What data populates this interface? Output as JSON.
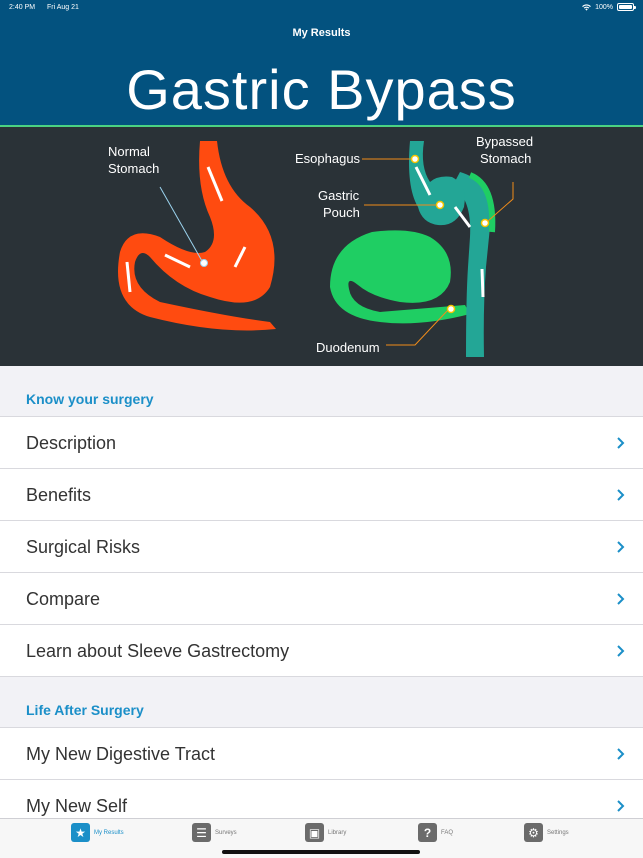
{
  "status": {
    "time": "2:40 PM",
    "date": "Fri Aug 21",
    "battery": "100%",
    "battery_level": 1.0
  },
  "header": {
    "nav_title": "My Results",
    "title": "Gastric Bypass"
  },
  "diagram": {
    "normal_stomach": "Normal\nStomach",
    "normal_stomach_l1": "Normal",
    "normal_stomach_l2": "Stomach",
    "esophagus": "Esophagus",
    "gastric_pouch_l1": "Gastric",
    "gastric_pouch_l2": "Pouch",
    "bypassed_l1": "Bypassed",
    "bypassed_l2": "Stomach",
    "duodenum": "Duodenum",
    "colors": {
      "normal": "#ff4b10",
      "bypass": "#1fce63",
      "pouch": "#23a696",
      "leader": "#f08c1a",
      "background": "#2a3237"
    }
  },
  "sections": [
    {
      "title": "Know your surgery",
      "items": [
        {
          "label": "Description"
        },
        {
          "label": "Benefits"
        },
        {
          "label": "Surgical Risks"
        },
        {
          "label": "Compare"
        },
        {
          "label": "Learn about Sleeve Gastrectomy"
        }
      ]
    },
    {
      "title": "Life After Surgery",
      "items": [
        {
          "label": "My New Digestive Tract"
        },
        {
          "label": "My New Self"
        }
      ]
    }
  ],
  "tabs": [
    {
      "label": "My Results",
      "icon": "star-icon",
      "glyph": "★"
    },
    {
      "label": "Surveys",
      "icon": "list-icon",
      "glyph": "☰"
    },
    {
      "label": "Library",
      "icon": "book-icon",
      "glyph": "▣"
    },
    {
      "label": "FAQ",
      "icon": "question-icon",
      "glyph": "?"
    },
    {
      "label": "Settings",
      "icon": "gear-icon",
      "glyph": "⚙"
    }
  ],
  "colors": {
    "header": "#03527f",
    "accent": "#1b8fc8"
  }
}
